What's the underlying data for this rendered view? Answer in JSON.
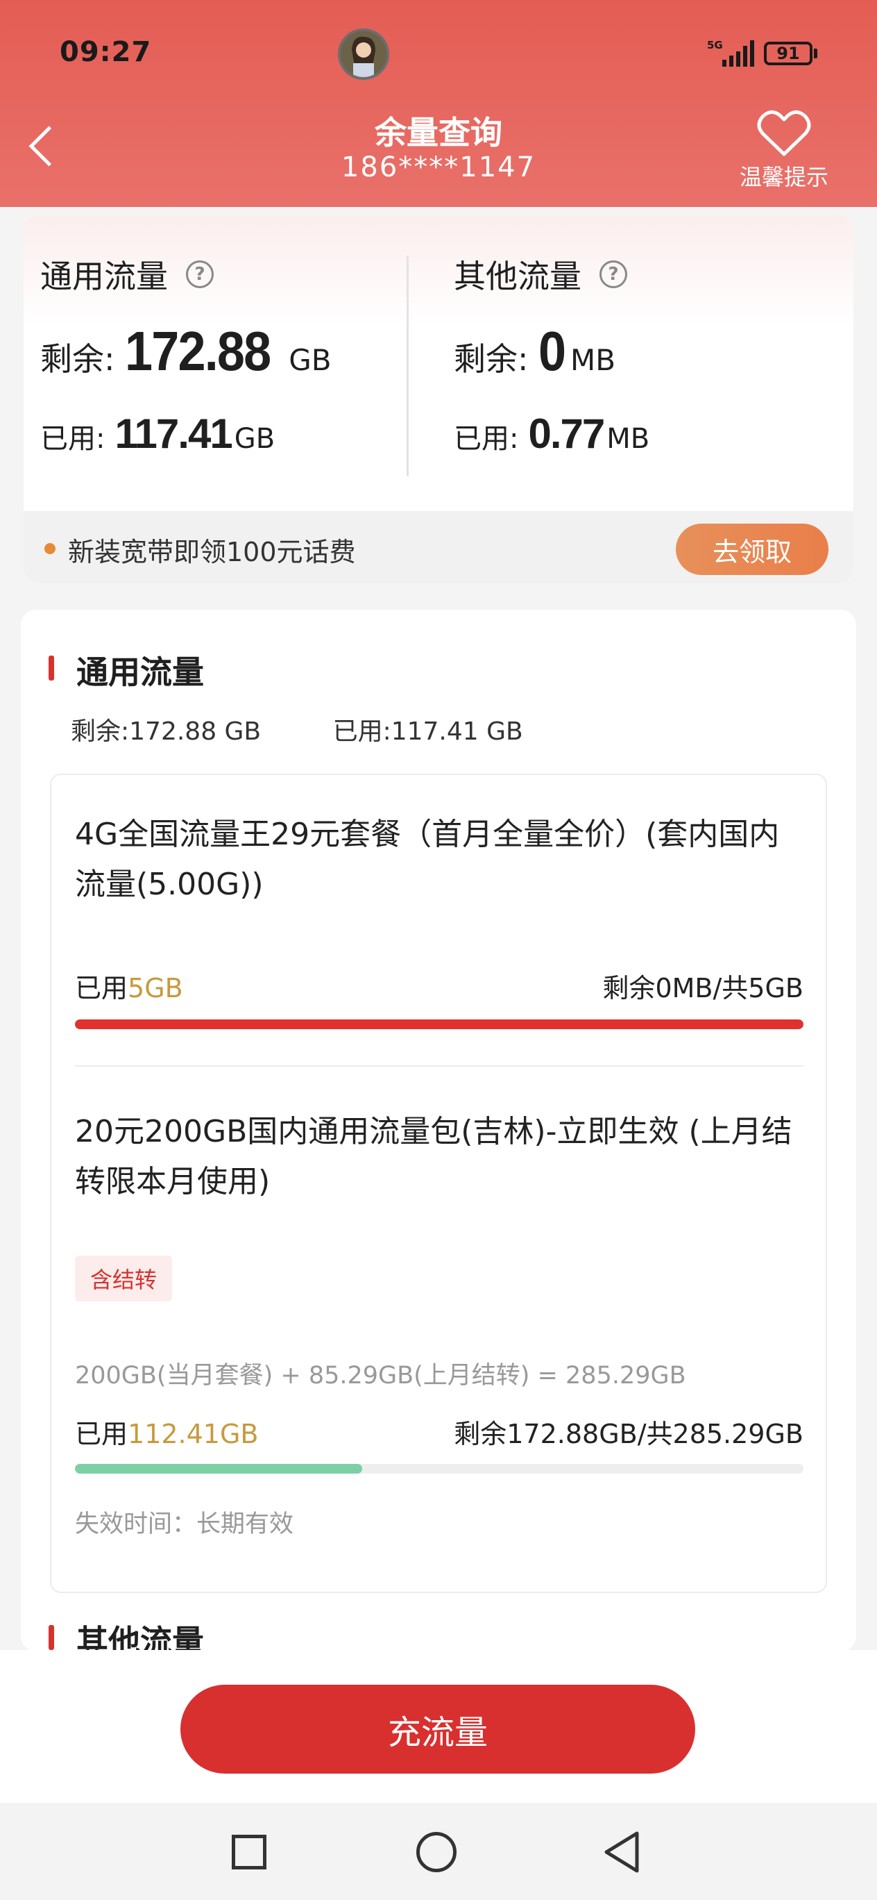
{
  "status_bar": {
    "time": "09:27",
    "network": "5G",
    "battery": "91"
  },
  "header": {
    "title": "余量查询",
    "phone": "186****1147",
    "tips_label": "温馨提示"
  },
  "summary": {
    "general": {
      "title": "通用流量",
      "remain_label": "剩余:",
      "remain_value": "172.88",
      "remain_unit": "GB",
      "used_label": "已用:",
      "used_value": "117.41",
      "used_unit": "GB"
    },
    "other": {
      "title": "其他流量",
      "remain_label": "剩余:",
      "remain_value": "0",
      "remain_unit": "MB",
      "used_label": "已用:",
      "used_value": "0.77",
      "used_unit": "MB"
    },
    "promo": {
      "text": "新装宽带即领100元话费",
      "button": "去领取"
    }
  },
  "detail": {
    "section_title": "通用流量",
    "summary_remain": "剩余:172.88 GB",
    "summary_used": "已用:117.41 GB",
    "packages": [
      {
        "name": "4G全国流量王29元套餐（首月全量全价）(套内国内流量(5.00G))",
        "used_label": "已用",
        "used_value": "5GB",
        "remain_text": "剩余0MB/共5GB",
        "progress": 1.0,
        "color": "#e0312c"
      },
      {
        "name": "20元200GB国内通用流量包(吉林)-立即生效 (上月结转限本月使用)",
        "tag": "含结转",
        "formula": "200GB(当月套餐) + 85.29GB(上月结转) = 285.29GB",
        "used_label": "已用",
        "used_value": "112.41GB",
        "remain_text": "剩余172.88GB/共285.29GB",
        "progress": 0.394,
        "color": "#7dcfa4",
        "expire": "失效时间：长期有效"
      }
    ],
    "next_section_title": "其他流量"
  },
  "bottom": {
    "recharge_button": "充流量"
  }
}
